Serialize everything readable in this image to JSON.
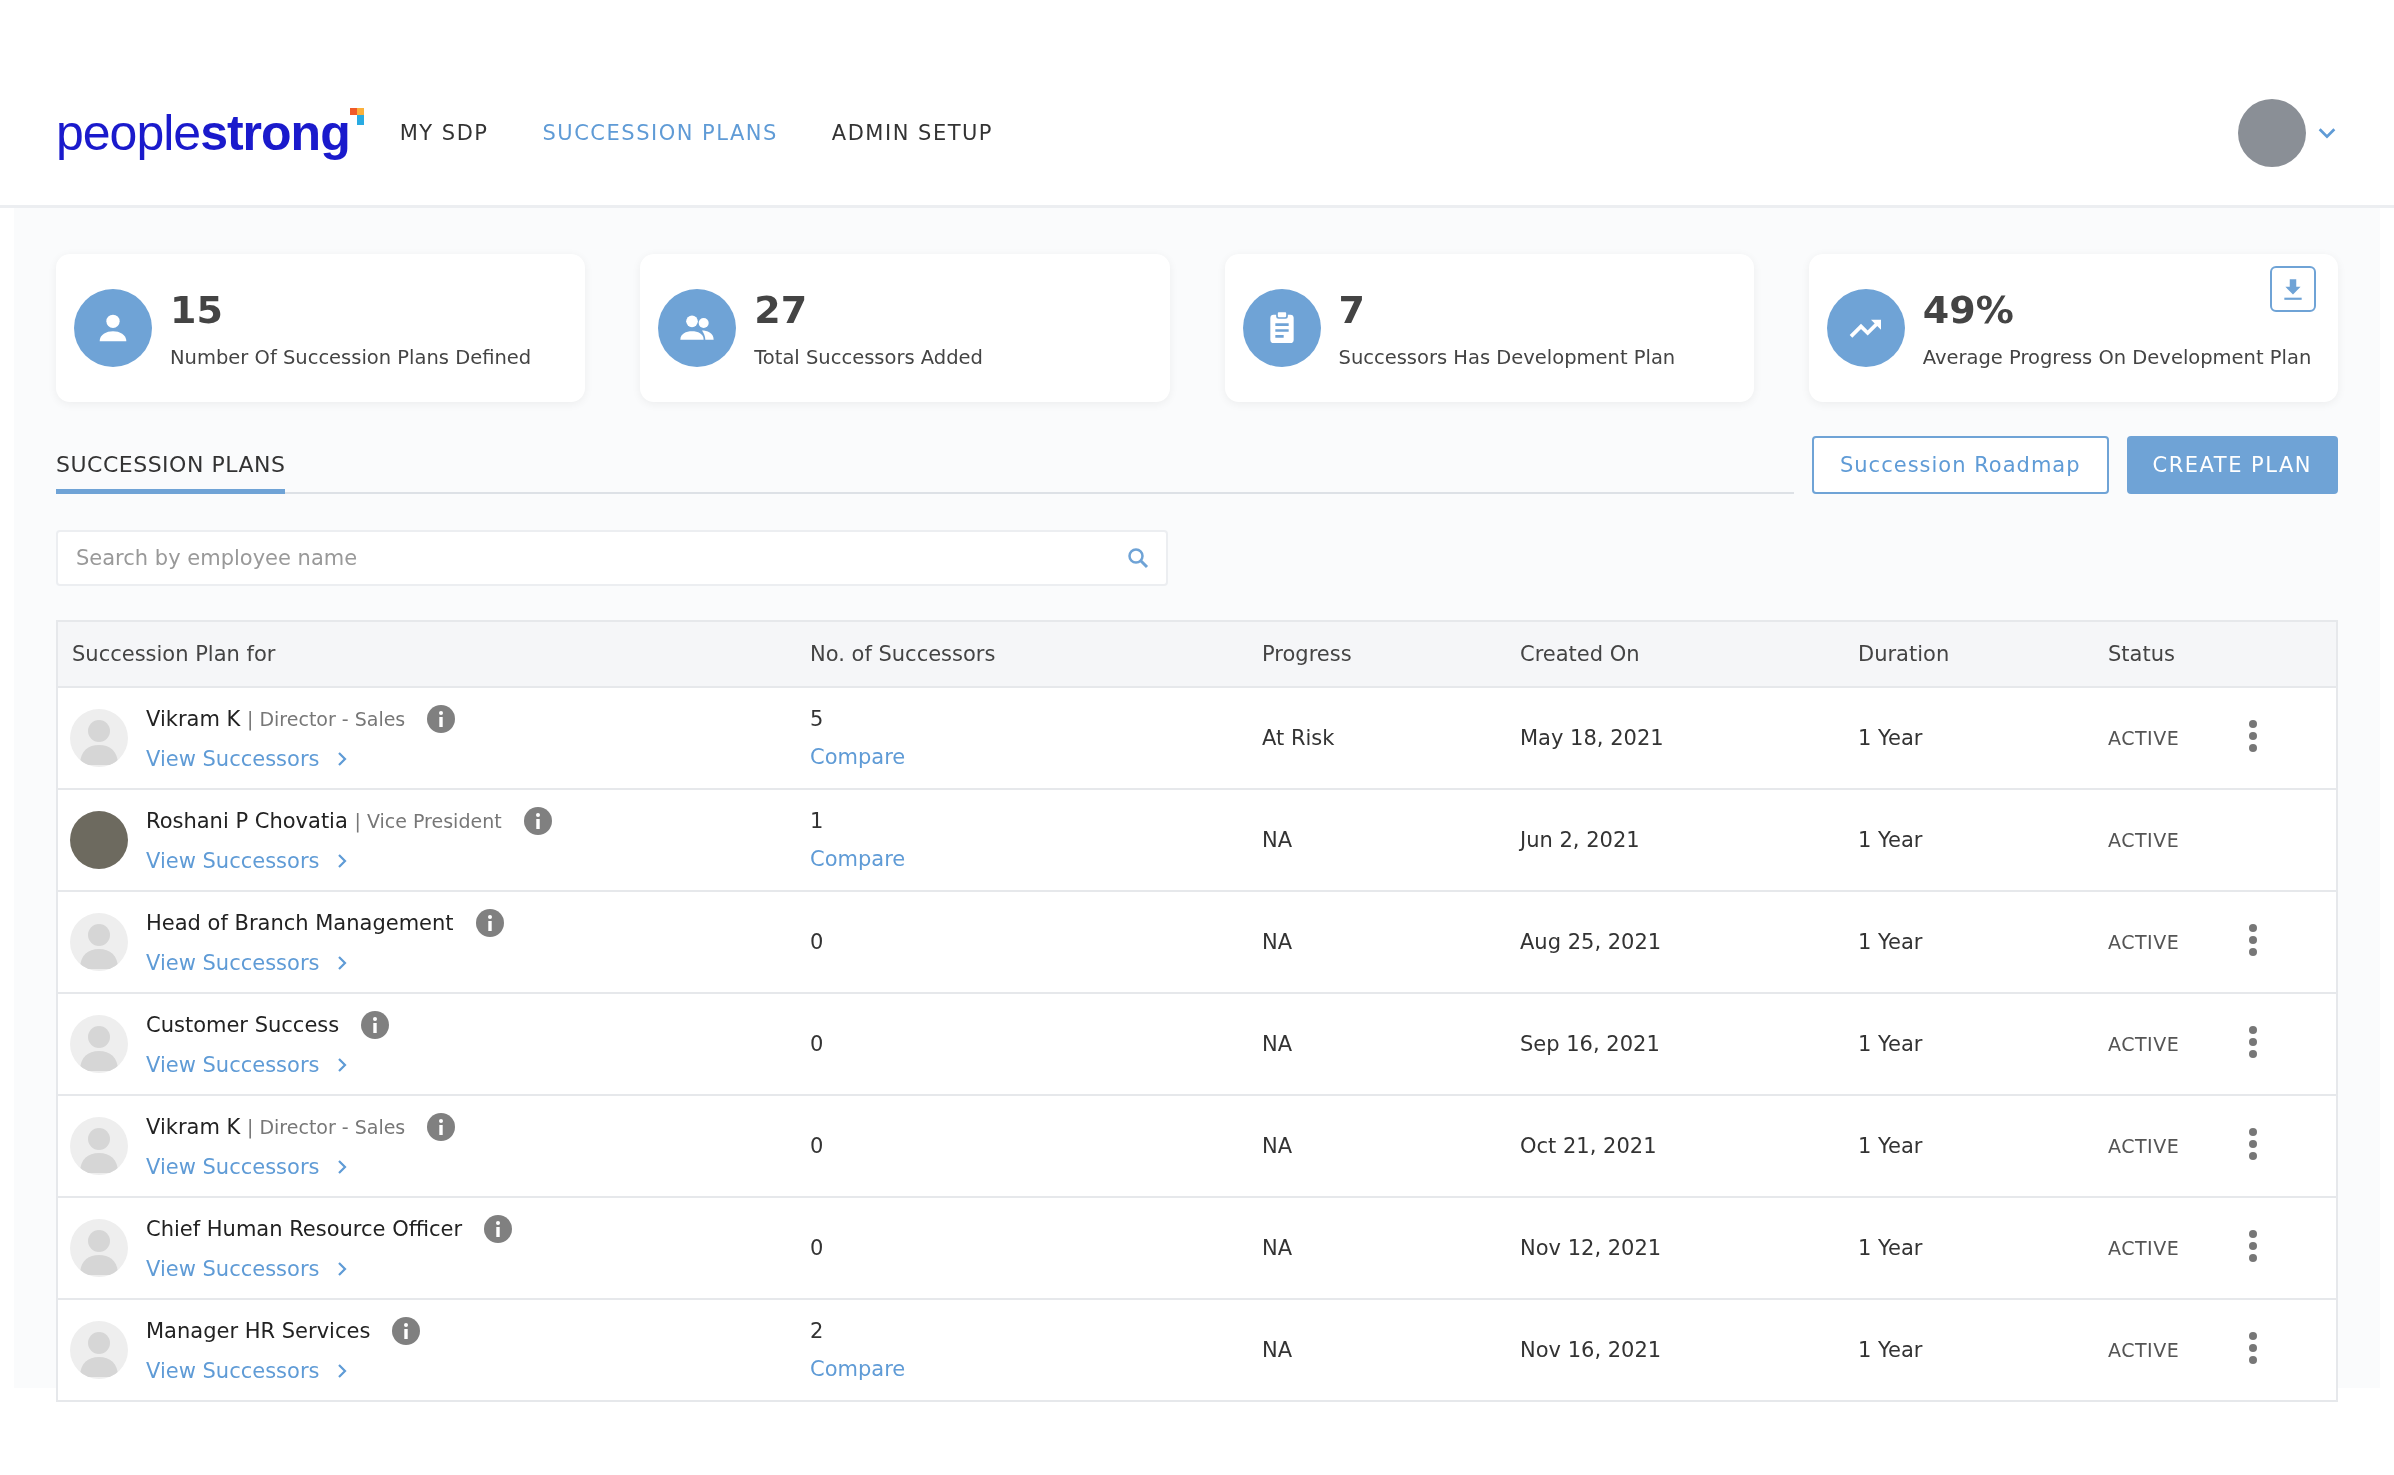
{
  "header": {
    "logo": {
      "light": "people",
      "bold": "strong"
    },
    "nav": [
      {
        "label": "MY SDP",
        "selected": false
      },
      {
        "label": "SUCCESSION PLANS",
        "selected": true
      },
      {
        "label": "ADMIN SETUP",
        "selected": false
      }
    ]
  },
  "stats": [
    {
      "value": "15",
      "label": "Number Of Succession Plans Defined",
      "download": false
    },
    {
      "value": "27",
      "label": "Total Successors Added",
      "download": false
    },
    {
      "value": "7",
      "label": "Successors Has Development Plan",
      "download": false
    },
    {
      "value": "49%",
      "label": "Average Progress On Development Plan",
      "download": true
    }
  ],
  "tabs": [
    {
      "label": "SUCCESSION PLANS",
      "selected": true
    }
  ],
  "buttons": {
    "roadmap": "Succession Roadmap",
    "create": "CREATE PLAN"
  },
  "search": {
    "placeholder": "Search by employee name"
  },
  "table": {
    "columns": [
      "Succession Plan for",
      "No. of Successors",
      "Progress",
      "Created On",
      "Duration",
      "Status"
    ],
    "rows": [
      {
        "kind": "default",
        "name": "Vikram K",
        "role": "| Director - Sales",
        "link": "View Successors",
        "successors": "5",
        "compare": "Compare",
        "progress": "At Risk",
        "created": "May 18, 2021",
        "duration": "1 Year",
        "status": "ACTIVE",
        "menu": true
      },
      {
        "kind": "photo",
        "name": "Roshani P Chovatia",
        "role": "| Vice President",
        "link": "View Successors",
        "successors": "1",
        "compare": "Compare",
        "progress": "NA",
        "created": "Jun 2, 2021",
        "duration": "1 Year",
        "status": "ACTIVE",
        "menu": false
      },
      {
        "kind": "default",
        "name": "Head of Branch Management",
        "link": "View Successors",
        "successors": "0",
        "progress": "NA",
        "created": "Aug 25, 2021",
        "duration": "1 Year",
        "status": "ACTIVE",
        "menu": true
      },
      {
        "kind": "default",
        "name": "Customer Success",
        "link": "View Successors",
        "successors": "0",
        "progress": "NA",
        "created": "Sep 16, 2021",
        "duration": "1 Year",
        "status": "ACTIVE",
        "menu": true
      },
      {
        "kind": "default",
        "name": "Vikram K",
        "role": "| Director - Sales",
        "link": "View Successors",
        "successors": "0",
        "progress": "NA",
        "created": "Oct 21, 2021",
        "duration": "1 Year",
        "status": "ACTIVE",
        "menu": true
      },
      {
        "kind": "default",
        "name": "Chief Human Resource Officer",
        "link": "View Successors",
        "successors": "0",
        "progress": "NA",
        "created": "Nov 12, 2021",
        "duration": "1 Year",
        "status": "ACTIVE",
        "menu": true
      },
      {
        "kind": "default",
        "name": "Manager HR Services",
        "link": "View Successors",
        "successors": "2",
        "compare": "Compare",
        "progress": "NA",
        "created": "Nov 16, 2021",
        "duration": "1 Year",
        "status": "ACTIVE",
        "menu": true
      }
    ]
  }
}
